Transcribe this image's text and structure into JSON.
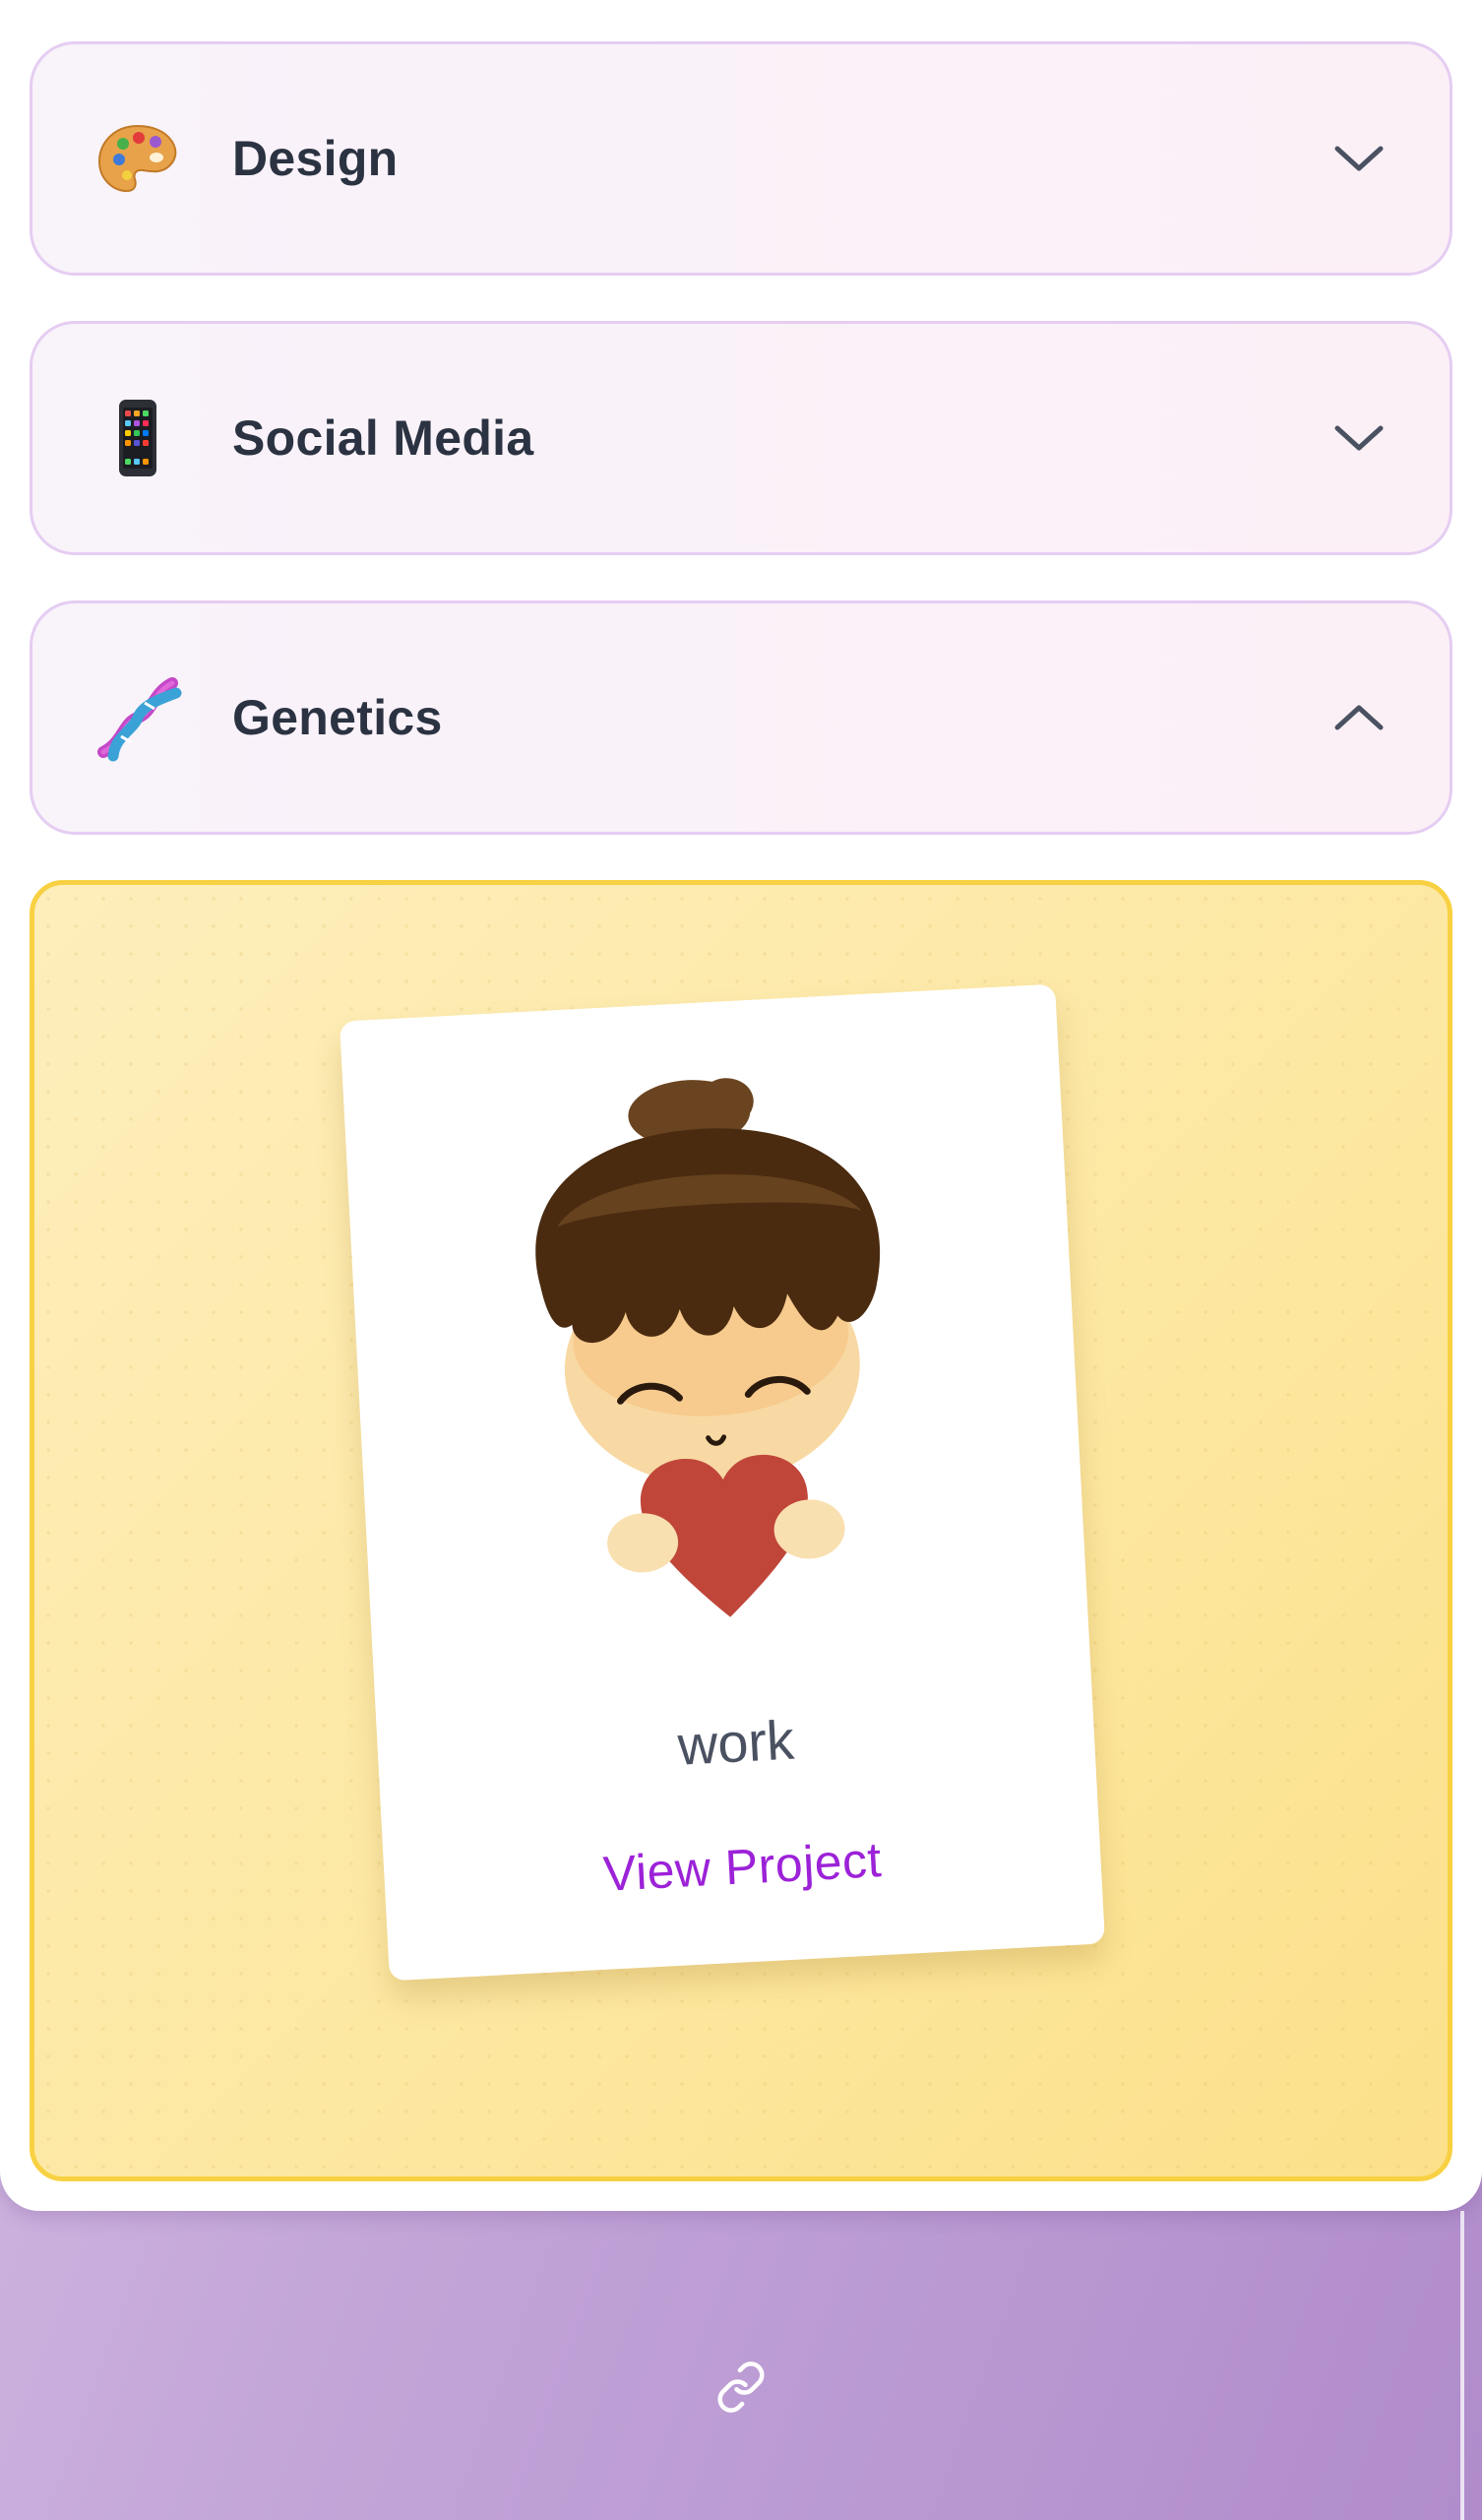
{
  "categories": [
    {
      "id": "design",
      "title": "Design",
      "icon": "artist-palette-icon",
      "expanded": false
    },
    {
      "id": "social-media",
      "title": "Social Media",
      "icon": "mobile-phone-icon",
      "expanded": false
    },
    {
      "id": "genetics",
      "title": "Genetics",
      "icon": "dna-icon",
      "expanded": true
    }
  ],
  "panel": {
    "card": {
      "image": "chibi-boy-holding-heart-illustration",
      "title": "work",
      "link_label": "View Project"
    }
  },
  "footer": {
    "icon": "link-icon"
  },
  "colors": {
    "accordion_border": "#e5cdf2",
    "panel_border": "#f8d143",
    "link_text": "#9c22d8",
    "heading_text": "#2b3342",
    "footer_gradient_start": "#dcc6e8",
    "footer_gradient_end": "#b08ccb"
  }
}
